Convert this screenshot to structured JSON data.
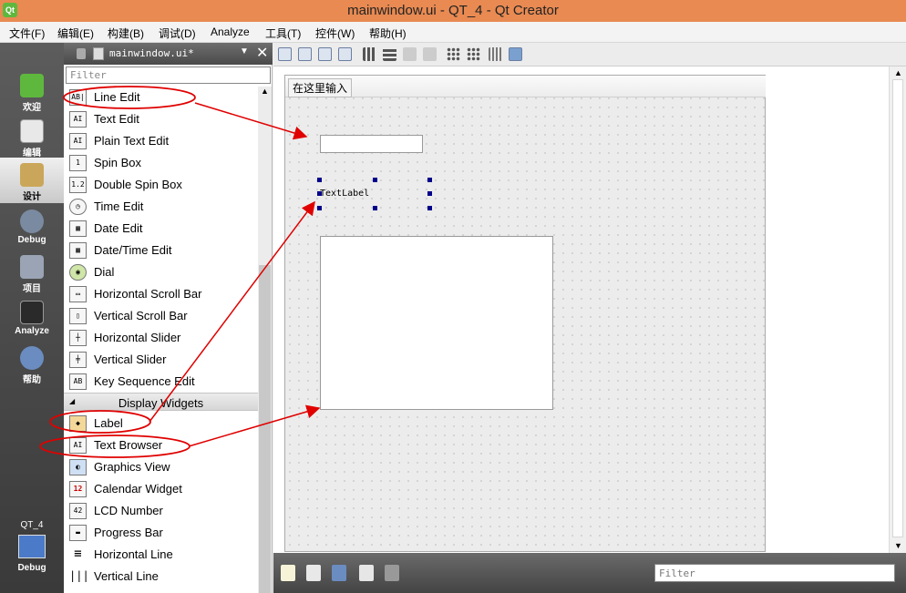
{
  "window": {
    "title": "mainwindow.ui - QT_4 - Qt Creator",
    "app_icon_text": "Qt"
  },
  "menu": [
    "文件(F)",
    "编辑(E)",
    "构建(B)",
    "调试(D)",
    "Analyze",
    "工具(T)",
    "控件(W)",
    "帮助(H)"
  ],
  "modes": [
    {
      "label": "欢迎",
      "icon": "qt-welcome-icon"
    },
    {
      "label": "编辑",
      "icon": "edit-document-icon"
    },
    {
      "label": "设计",
      "icon": "design-brush-icon",
      "active": true
    },
    {
      "label": "Debug",
      "icon": "debug-bug-icon"
    },
    {
      "label": "项目",
      "icon": "project-wrench-icon"
    },
    {
      "label": "Analyze",
      "icon": "analyze-screen-icon"
    },
    {
      "label": "帮助",
      "icon": "help-question-icon"
    }
  ],
  "project_selector": {
    "name": "QT_4",
    "config": "Debug"
  },
  "widget_box": {
    "document": "mainwindow.ui*",
    "filter_placeholder": "Filter",
    "items": [
      {
        "label": "Line Edit",
        "icon": "AB|"
      },
      {
        "label": "Text Edit",
        "icon": "AI"
      },
      {
        "label": "Plain Text Edit",
        "icon": "AI"
      },
      {
        "label": "Spin Box",
        "icon": "1"
      },
      {
        "label": "Double Spin Box",
        "icon": "1.2"
      },
      {
        "label": "Time Edit",
        "icon": "◷"
      },
      {
        "label": "Date Edit",
        "icon": "▦"
      },
      {
        "label": "Date/Time Edit",
        "icon": "▦"
      },
      {
        "label": "Dial",
        "icon": "◉"
      },
      {
        "label": "Horizontal Scroll Bar",
        "icon": "▭"
      },
      {
        "label": "Vertical Scroll Bar",
        "icon": "▯"
      },
      {
        "label": "Horizontal Slider",
        "icon": "┼"
      },
      {
        "label": "Vertical Slider",
        "icon": "╪"
      },
      {
        "label": "Key Sequence Edit",
        "icon": "AB"
      }
    ],
    "category": "Display Widgets",
    "display_items": [
      {
        "label": "Label",
        "icon": "◆"
      },
      {
        "label": "Text Browser",
        "icon": "AI"
      },
      {
        "label": "Graphics View",
        "icon": "◐"
      },
      {
        "label": "Calendar Widget",
        "icon": "12"
      },
      {
        "label": "LCD Number",
        "icon": "42"
      },
      {
        "label": "Progress Bar",
        "icon": "▬"
      },
      {
        "label": "Horizontal Line",
        "icon": "≡"
      },
      {
        "label": "Vertical Line",
        "icon": "|||"
      }
    ]
  },
  "form": {
    "menu_placeholder": "在这里输入",
    "label_text": "TextLabel"
  },
  "bottom": {
    "filter_placeholder": "Filter"
  },
  "colors": {
    "title_bar": "#e88a52",
    "annotation": "#e00000",
    "selection_handle": "#00008b"
  }
}
